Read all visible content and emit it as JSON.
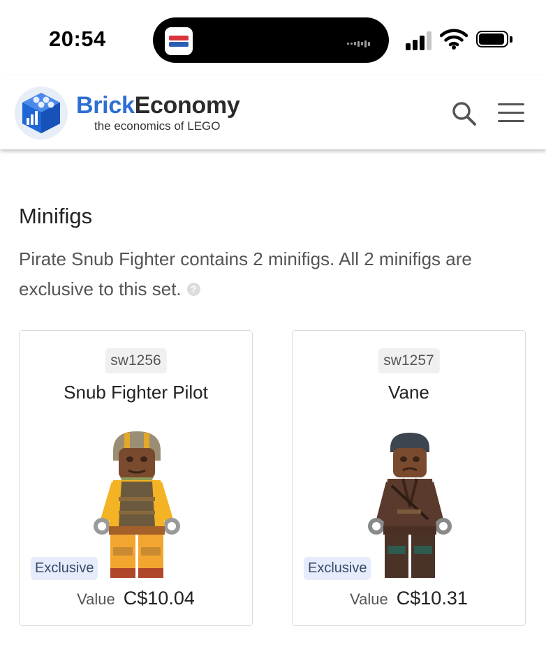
{
  "status_bar": {
    "time": "20:54",
    "icons": [
      "cellular-signal-icon",
      "wifi-icon",
      "battery-icon"
    ]
  },
  "header": {
    "brand_part1": "Brick",
    "brand_part2": "Economy",
    "tagline": "the economics of LEGO",
    "icons": [
      "search-icon",
      "hamburger-menu-icon"
    ],
    "colors": {
      "brand_blue": "#2d6fd3",
      "brand_dark": "#2b2b2b"
    }
  },
  "section": {
    "title": "Minifigs",
    "description": "Pirate Snub Fighter contains 2 minifigs. All 2 minifigs are exclusive to this set.",
    "help_symbol": "?"
  },
  "minifigs": [
    {
      "id": "sw1256",
      "name": "Snub Fighter Pilot",
      "badge": "Exclusive",
      "value_label": "Value",
      "value": "C$10.04"
    },
    {
      "id": "sw1257",
      "name": "Vane",
      "badge": "Exclusive",
      "value_label": "Value",
      "value": "C$10.31"
    }
  ]
}
